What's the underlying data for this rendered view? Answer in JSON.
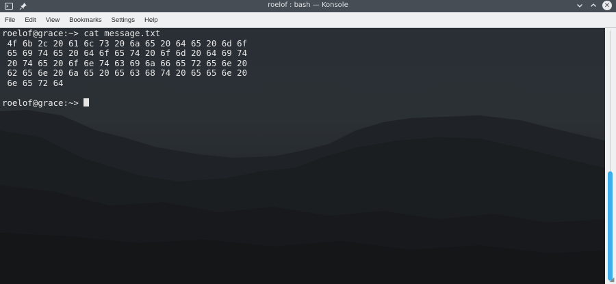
{
  "window": {
    "title": "roelof : bash — Konsole",
    "icons": [
      "konsole-app-icon",
      "pin-icon",
      "minimize-icon",
      "maximize-icon",
      "close-icon"
    ]
  },
  "menu": {
    "items": [
      "File",
      "Edit",
      "View",
      "Bookmarks",
      "Settings",
      "Help"
    ]
  },
  "terminal": {
    "lines": [
      "roelof@grace:~> cat message.txt",
      " 4f 6b 2c 20 61 6c 73 20 6a 65 20 64 65 20 6d 6f",
      " 65 69 74 65 20 64 6f 65 74 20 6f 6d 20 64 69 74",
      " 20 74 65 20 6f 6e 74 63 69 6a 66 65 72 65 6e 20",
      " 62 65 6e 20 6a 65 20 65 63 68 74 20 65 65 6e 20",
      " 6e 65 72 64",
      ""
    ],
    "prompt": "roelof@grace:~> ",
    "colors": {
      "text": "#e6e6e6",
      "background": "#1e2226"
    }
  },
  "scrollbar": {
    "accent": "#3daee9"
  }
}
